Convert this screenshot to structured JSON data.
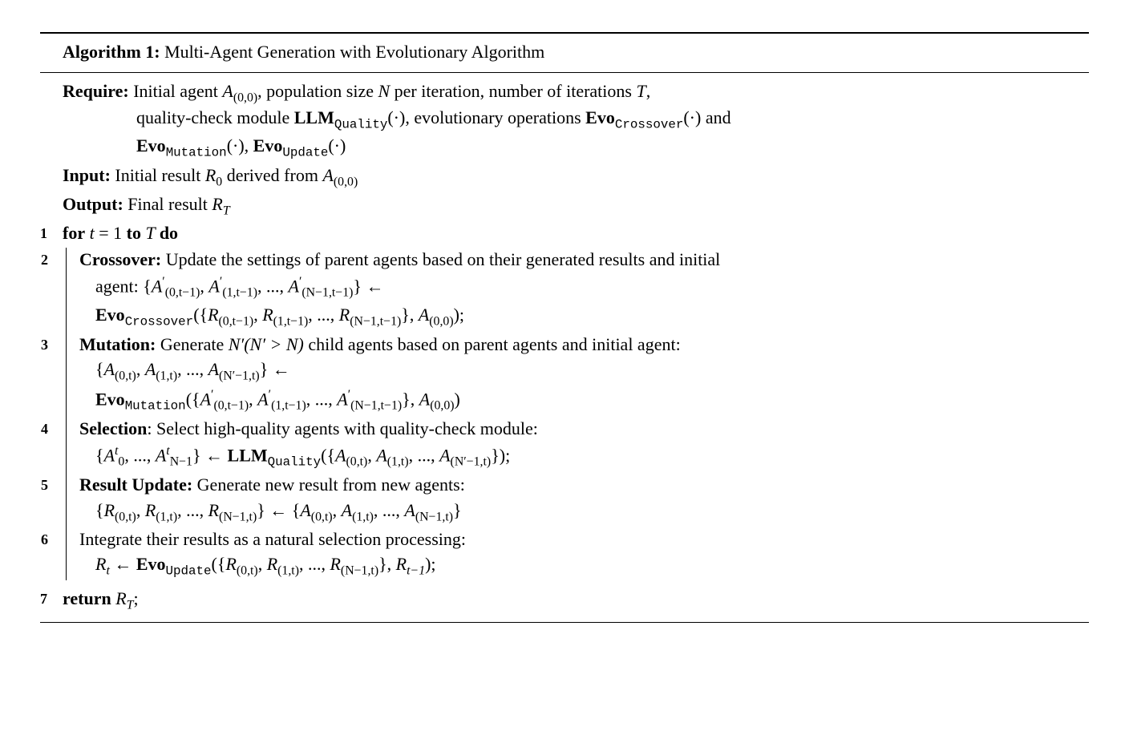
{
  "header": {
    "label": "Algorithm 1:",
    "title": "Multi-Agent Generation with Evolutionary Algorithm"
  },
  "require": {
    "label": "Require:",
    "line1a": "Initial agent ",
    "line1a_math": "A",
    "line1a_sub": "(0,0)",
    "line1b": ", population size ",
    "line1b_math": "N",
    "line1c": " per iteration, number of iterations ",
    "line1c_math": "T",
    "line1d": ",",
    "line2a": "quality-check module ",
    "line2_llm": "LLM",
    "line2_llm_sub": "Quality",
    "line2b": "(·), evolutionary operations ",
    "line2_evo": "Evo",
    "line2_evo_sub": "Crossover",
    "line2c": "(·) and",
    "line3_evo1": "Evo",
    "line3_evo1_sub": "Mutation",
    "line3a": "(·), ",
    "line3_evo2": "Evo",
    "line3_evo2_sub": "Update",
    "line3b": "(·)"
  },
  "input": {
    "label": "Input:",
    "text1": " Initial result ",
    "R": "R",
    "R_sub": "0",
    "text2": " derived from ",
    "A": "A",
    "A_sub": "(0,0)"
  },
  "output": {
    "label": "Output:",
    "text": " Final result ",
    "R": "R",
    "R_sub": "T"
  },
  "lines": {
    "n1": "1",
    "n2": "2",
    "n3": "3",
    "n4": "4",
    "n5": "5",
    "n6": "6",
    "n7": "7"
  },
  "for": {
    "kw_for": "for",
    "var": "t",
    "eq": " = 1 ",
    "kw_to": "to",
    "T": " T ",
    "kw_do": "do"
  },
  "step2": {
    "label": "Crossover:",
    "text": " Update the settings of parent agents based on their generated results and initial",
    "text2": "agent: ",
    "set_open": "{",
    "A": "A",
    "prime": "′",
    "sub0": "(0,t−1)",
    "sub1": "(1,t−1)",
    "subN": "(N−1,t−1)",
    "dots": ", ..., ",
    "set_close": "}",
    "arrow": " ←",
    "evo": "Evo",
    "evo_sub": "Crossover",
    "paren_open": "(",
    "R": "R",
    "Rsub0": "(0,t−1)",
    "Rsub1": "(1,t−1)",
    "RsubN": "(N−1,t−1)",
    "comma_A": ", ",
    "A00": "A",
    "A00_sub": "(0,0)",
    "paren_close": ");"
  },
  "step3": {
    "label": "Mutation:",
    "text": " Generate ",
    "Nprime": "N′",
    "cond": "(N′ > N)",
    "text2": " child agents based on parent agents and initial agent:",
    "set_open": "{",
    "A": "A",
    "sub0": "(0,t)",
    "sub1": "(1,t)",
    "subN": "(N′−1,t)",
    "dots": ", ..., ",
    "set_close": "}",
    "arrow": " ←",
    "evo": "Evo",
    "evo_sub": "Mutation",
    "paren_open": "(",
    "prime": "′",
    "psub0": "(0,t−1)",
    "psub1": "(1,t−1)",
    "psubN": "(N−1,t−1)",
    "comma_A": ", ",
    "A00": "A",
    "A00_sub": "(0,0)",
    "paren_close": ")"
  },
  "step4": {
    "label": "Selection",
    "colon": ":",
    "text": " Select high-quality agents with quality-check module:",
    "set_open": "{",
    "A": "A",
    "sup": "t",
    "sub0": "0",
    "dots": ", ..., ",
    "subN": "N−1",
    "set_close": "}",
    "arrow": " ← ",
    "llm": "LLM",
    "llm_sub": "Quality",
    "paren_open": "(",
    "in_open": "{",
    "in_A": "A",
    "in_sub0": "(0,t)",
    "in_sub1": "(1,t)",
    "in_subN": "(N′−1,t)",
    "in_close": "}",
    "paren_close": ");"
  },
  "step5": {
    "label": "Result Update:",
    "text": " Generate new result from new agents:",
    "set_open": "{",
    "R": "R",
    "sub0": "(0,t)",
    "sub1": "(1,t)",
    "subN": "(N−1,t)",
    "dots": ", ..., ",
    "set_close": "}",
    "arrow": " ← ",
    "A": "A"
  },
  "step6": {
    "text": "Integrate their results as a natural selection processing:",
    "R": "R",
    "Rsub": "t",
    "arrow": " ← ",
    "evo": "Evo",
    "evo_sub": "Update",
    "paren_open": "(",
    "set_open": "{",
    "Rin": "R",
    "sub0": "(0,t)",
    "sub1": "(1,t)",
    "subN": "(N−1,t)",
    "dots": ", ..., ",
    "set_close": "}",
    "comma": ", ",
    "Rprev": "R",
    "Rprev_sub": "t−1",
    "paren_close": ");"
  },
  "return": {
    "kw": "return",
    "R": " R",
    "R_sub": "T",
    "semi": ";"
  }
}
